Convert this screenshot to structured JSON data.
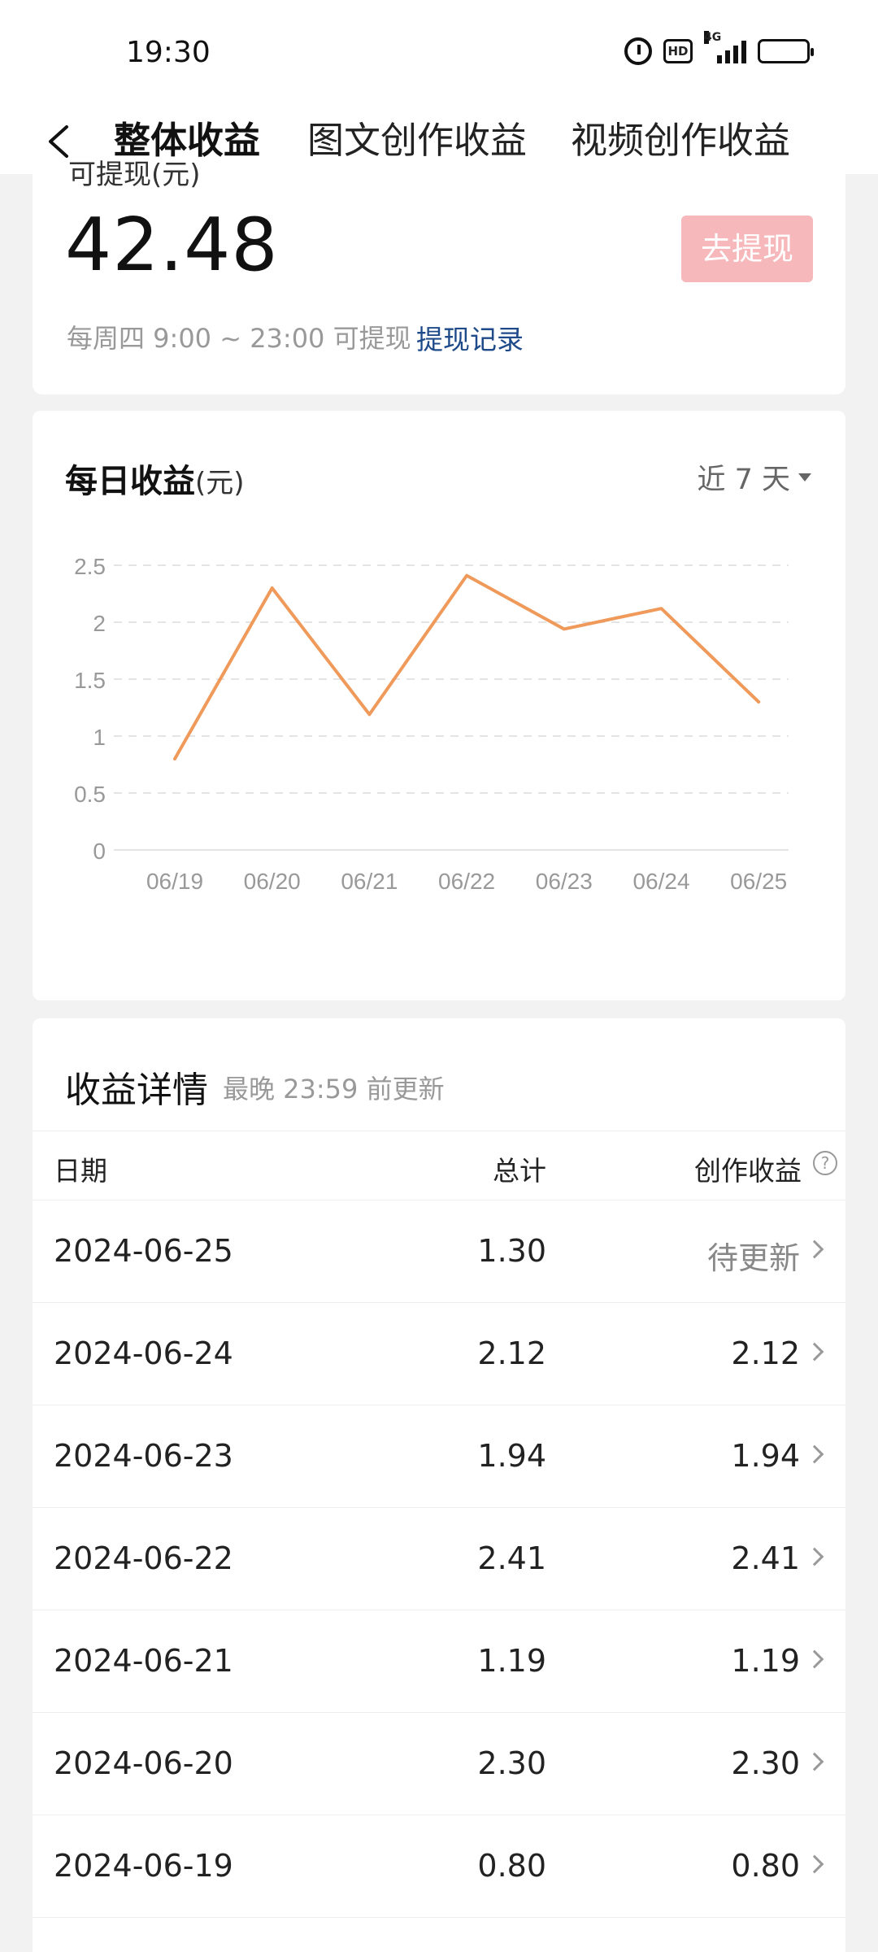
{
  "status": {
    "time": "19:30",
    "hd": "HD",
    "network": "4G"
  },
  "tabs": [
    {
      "label": "整体收益"
    },
    {
      "label": "图文创作收益"
    },
    {
      "label": "视频创作收益"
    }
  ],
  "balance": {
    "label": "可提现(元)",
    "value": "42.48",
    "withdraw_button": "去提现",
    "note": "每周四 9:00 ~ 23:00 可提现",
    "record_link": "提现记录"
  },
  "chart_section": {
    "title": "每日收益",
    "unit": "(元)",
    "range": "近 7 天"
  },
  "chart_data": {
    "type": "line",
    "categories": [
      "06/19",
      "06/20",
      "06/21",
      "06/22",
      "06/23",
      "06/24",
      "06/25"
    ],
    "values": [
      0.8,
      2.3,
      1.19,
      2.41,
      1.94,
      2.12,
      1.3
    ],
    "yticks": [
      "0",
      "0.5",
      "1",
      "1.5",
      "2",
      "2.5"
    ],
    "ylim": [
      0,
      2.5
    ],
    "grid": true,
    "color": "#ef9a5a"
  },
  "detail": {
    "title": "收益详情",
    "subtitle": "最晚 23:59 前更新",
    "headers": {
      "date": "日期",
      "total": "总计",
      "earn": "创作收益"
    },
    "rows": [
      {
        "date": "2024-06-25",
        "total": "1.30",
        "earn": "待更新"
      },
      {
        "date": "2024-06-24",
        "total": "2.12",
        "earn": "2.12"
      },
      {
        "date": "2024-06-23",
        "total": "1.94",
        "earn": "1.94"
      },
      {
        "date": "2024-06-22",
        "total": "2.41",
        "earn": "2.41"
      },
      {
        "date": "2024-06-21",
        "total": "1.19",
        "earn": "1.19"
      },
      {
        "date": "2024-06-20",
        "total": "2.30",
        "earn": "2.30"
      },
      {
        "date": "2024-06-19",
        "total": "0.80",
        "earn": "0.80"
      }
    ]
  }
}
